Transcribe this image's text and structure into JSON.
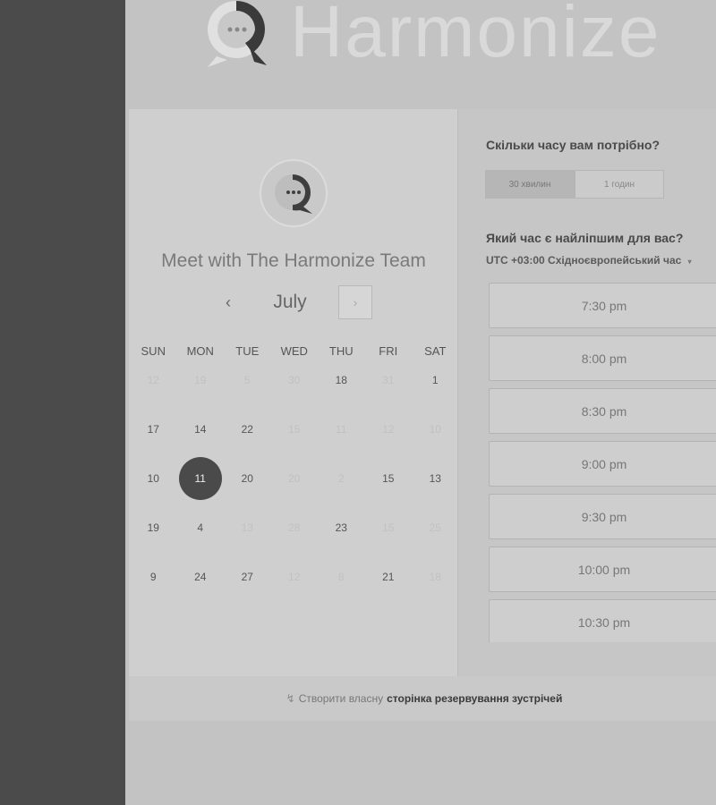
{
  "brand": {
    "name": "Harmonize"
  },
  "meeting": {
    "title": "Meet with The Harmonize Team"
  },
  "calendar": {
    "month": "July",
    "prev_label": "‹",
    "next_label": "›",
    "weekdays": [
      "SUN",
      "MON",
      "TUE",
      "WED",
      "THU",
      "FRI",
      "SAT"
    ],
    "weeks": [
      [
        {
          "d": "12",
          "on": false
        },
        {
          "d": "19",
          "on": false
        },
        {
          "d": "5",
          "on": false
        },
        {
          "d": "30",
          "on": false
        },
        {
          "d": "18",
          "on": true
        },
        {
          "d": "31",
          "on": false
        },
        {
          "d": "1",
          "on": true
        }
      ],
      [
        {
          "d": "17",
          "on": true
        },
        {
          "d": "14",
          "on": true
        },
        {
          "d": "22",
          "on": true
        },
        {
          "d": "15",
          "on": false
        },
        {
          "d": "11",
          "on": false
        },
        {
          "d": "12",
          "on": false
        },
        {
          "d": "10",
          "on": false
        }
      ],
      [
        {
          "d": "10",
          "on": true
        },
        {
          "d": "11",
          "on": true,
          "sel": true
        },
        {
          "d": "20",
          "on": true
        },
        {
          "d": "20",
          "on": false
        },
        {
          "d": "2",
          "on": false
        },
        {
          "d": "15",
          "on": true
        },
        {
          "d": "13",
          "on": true
        }
      ],
      [
        {
          "d": "19",
          "on": true
        },
        {
          "d": "4",
          "on": true
        },
        {
          "d": "13",
          "on": false
        },
        {
          "d": "28",
          "on": false
        },
        {
          "d": "23",
          "on": true
        },
        {
          "d": "15",
          "on": false
        },
        {
          "d": "25",
          "on": false
        }
      ],
      [
        {
          "d": "9",
          "on": true
        },
        {
          "d": "24",
          "on": true
        },
        {
          "d": "27",
          "on": true
        },
        {
          "d": "12",
          "on": false
        },
        {
          "d": "8",
          "on": false
        },
        {
          "d": "21",
          "on": true
        },
        {
          "d": "18",
          "on": false
        }
      ]
    ]
  },
  "booking": {
    "duration_question": "Скільки часу вам потрібно?",
    "durations": [
      "30 хвилин",
      "1 годин"
    ],
    "time_question": "Який час є найліпшим для вас?",
    "timezone": "UTC +03:00 Східноєвропейський час",
    "slots": [
      "7:30 pm",
      "8:00 pm",
      "8:30 pm",
      "9:00 pm",
      "9:30 pm",
      "10:00 pm",
      "10:30 pm"
    ]
  },
  "footer": {
    "prefix": "Створити власну",
    "link": "сторінка резервування зустрічей"
  }
}
